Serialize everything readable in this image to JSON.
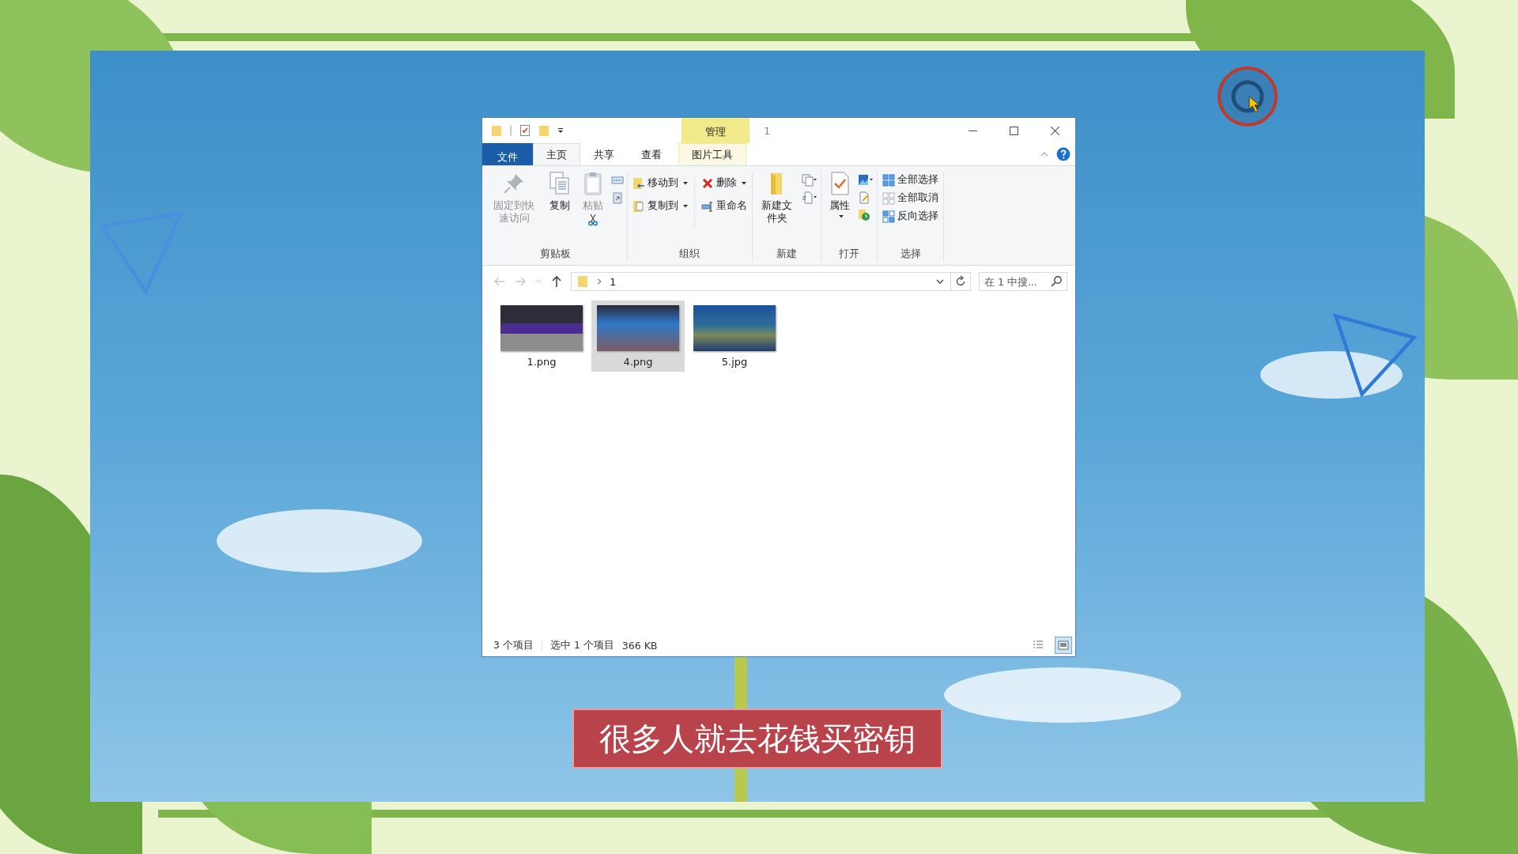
{
  "window": {
    "quick_access_separator": "|",
    "context_group": "管理",
    "title": "1"
  },
  "ribbon_tabs": [
    {
      "label": "文件",
      "kind": "file",
      "selected": false
    },
    {
      "label": "主页",
      "kind": "tab",
      "selected": true
    },
    {
      "label": "共享",
      "kind": "tab",
      "selected": false
    },
    {
      "label": "查看",
      "kind": "tab",
      "selected": false
    },
    {
      "label": "图片工具",
      "kind": "context",
      "selected": false
    }
  ],
  "ribbon_groups": [
    {
      "label": "剪贴板",
      "commands": [
        {
          "label": "固定到快速访问",
          "disabled": true
        },
        {
          "label": "复制",
          "disabled": false
        },
        {
          "label": "粘贴",
          "disabled": true
        }
      ]
    },
    {
      "label": "组织",
      "commands": [
        {
          "label": "移动到"
        },
        {
          "label": "复制到"
        },
        {
          "label": "删除"
        },
        {
          "label": "重命名"
        }
      ]
    },
    {
      "label": "新建",
      "commands": [
        {
          "label": "新建文件夹"
        }
      ]
    },
    {
      "label": "打开",
      "commands": [
        {
          "label": "属性"
        }
      ]
    },
    {
      "label": "选择",
      "commands": [
        {
          "label": "全部选择"
        },
        {
          "label": "全部取消"
        },
        {
          "label": "反向选择"
        }
      ]
    }
  ],
  "address_bar": {
    "path": "1",
    "search": {
      "placeholder": "在 1 中搜..."
    }
  },
  "files": [
    {
      "name": "1.png",
      "selected": false
    },
    {
      "name": "4.png",
      "selected": true
    },
    {
      "name": "5.jpg",
      "selected": false
    }
  ],
  "status_bar": {
    "item_count": "3 个项目",
    "selection": "选中 1 个项目",
    "size": "366 KB",
    "views": [
      {
        "kind": "details",
        "selected": false
      },
      {
        "kind": "large_icons",
        "selected": true
      }
    ]
  },
  "caption": "很多人就去花钱买密钥"
}
